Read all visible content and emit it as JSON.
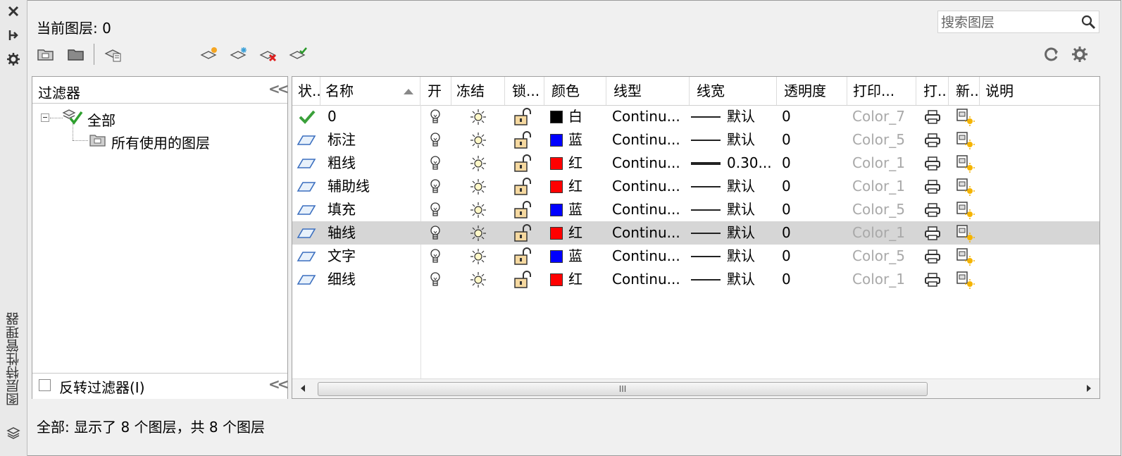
{
  "side_panel": {
    "title": "图层特性管理器"
  },
  "header": {
    "current_layer": "当前图层: 0",
    "search_placeholder": "搜索图层"
  },
  "filters": {
    "header": "过滤器",
    "tree": [
      {
        "label": "全部",
        "icon": "all-layers-filter-icon"
      },
      {
        "label": "所有使用的图层",
        "icon": "used-layers-filter-icon"
      }
    ],
    "invert_label": "反转过滤器(I)",
    "invert_checked": false
  },
  "table": {
    "columns": [
      "状...",
      "名称",
      "开",
      "冻结",
      "锁...",
      "颜色",
      "线型",
      "线宽",
      "透明度",
      "打印...",
      "打..",
      "新..",
      "说明"
    ],
    "rows": [
      {
        "status": "current",
        "name": "0",
        "color_name": "白",
        "color_hex": "#000000",
        "linetype": "Continu...",
        "lineweight": "默认",
        "lw_thick": false,
        "transparency": "0",
        "plot_style": "Color_7",
        "selected": false
      },
      {
        "status": "layer",
        "name": "标注",
        "color_name": "蓝",
        "color_hex": "#0000ff",
        "linetype": "Continu...",
        "lineweight": "默认",
        "lw_thick": false,
        "transparency": "0",
        "plot_style": "Color_5",
        "selected": false
      },
      {
        "status": "layer",
        "name": "粗线",
        "color_name": "红",
        "color_hex": "#ff0000",
        "linetype": "Continu...",
        "lineweight": "0.30...",
        "lw_thick": true,
        "transparency": "0",
        "plot_style": "Color_1",
        "selected": false
      },
      {
        "status": "layer",
        "name": "辅助线",
        "color_name": "红",
        "color_hex": "#ff0000",
        "linetype": "Continu...",
        "lineweight": "默认",
        "lw_thick": false,
        "transparency": "0",
        "plot_style": "Color_1",
        "selected": false
      },
      {
        "status": "layer",
        "name": "填充",
        "color_name": "蓝",
        "color_hex": "#0000ff",
        "linetype": "Continu...",
        "lineweight": "默认",
        "lw_thick": false,
        "transparency": "0",
        "plot_style": "Color_5",
        "selected": false
      },
      {
        "status": "layer",
        "name": "轴线",
        "color_name": "红",
        "color_hex": "#ff0000",
        "linetype": "Continu...",
        "lineweight": "默认",
        "lw_thick": false,
        "transparency": "0",
        "plot_style": "Color_1",
        "selected": true
      },
      {
        "status": "layer",
        "name": "文字",
        "color_name": "蓝",
        "color_hex": "#0000ff",
        "linetype": "Continu...",
        "lineweight": "默认",
        "lw_thick": false,
        "transparency": "0",
        "plot_style": "Color_5",
        "selected": false
      },
      {
        "status": "layer",
        "name": "细线",
        "color_name": "红",
        "color_hex": "#ff0000",
        "linetype": "Continu...",
        "lineweight": "默认",
        "lw_thick": false,
        "transparency": "0",
        "plot_style": "Color_1",
        "selected": false
      }
    ]
  },
  "scrollbar": {
    "thumb_label": "III"
  },
  "status": {
    "text": "全部: 显示了 8 个图层，共 8 个图层"
  }
}
